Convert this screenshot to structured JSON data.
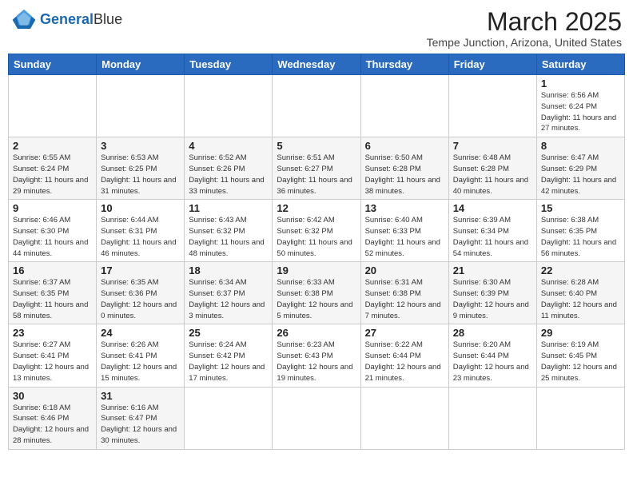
{
  "header": {
    "logo_general": "General",
    "logo_blue": "Blue",
    "month_title": "March 2025",
    "location": "Tempe Junction, Arizona, United States"
  },
  "days_of_week": [
    "Sunday",
    "Monday",
    "Tuesday",
    "Wednesday",
    "Thursday",
    "Friday",
    "Saturday"
  ],
  "weeks": [
    [
      {
        "num": "",
        "info": ""
      },
      {
        "num": "",
        "info": ""
      },
      {
        "num": "",
        "info": ""
      },
      {
        "num": "",
        "info": ""
      },
      {
        "num": "",
        "info": ""
      },
      {
        "num": "",
        "info": ""
      },
      {
        "num": "1",
        "info": "Sunrise: 6:56 AM\nSunset: 6:24 PM\nDaylight: 11 hours and 27 minutes."
      }
    ],
    [
      {
        "num": "2",
        "info": "Sunrise: 6:55 AM\nSunset: 6:24 PM\nDaylight: 11 hours and 29 minutes."
      },
      {
        "num": "3",
        "info": "Sunrise: 6:53 AM\nSunset: 6:25 PM\nDaylight: 11 hours and 31 minutes."
      },
      {
        "num": "4",
        "info": "Sunrise: 6:52 AM\nSunset: 6:26 PM\nDaylight: 11 hours and 33 minutes."
      },
      {
        "num": "5",
        "info": "Sunrise: 6:51 AM\nSunset: 6:27 PM\nDaylight: 11 hours and 36 minutes."
      },
      {
        "num": "6",
        "info": "Sunrise: 6:50 AM\nSunset: 6:28 PM\nDaylight: 11 hours and 38 minutes."
      },
      {
        "num": "7",
        "info": "Sunrise: 6:48 AM\nSunset: 6:28 PM\nDaylight: 11 hours and 40 minutes."
      },
      {
        "num": "8",
        "info": "Sunrise: 6:47 AM\nSunset: 6:29 PM\nDaylight: 11 hours and 42 minutes."
      }
    ],
    [
      {
        "num": "9",
        "info": "Sunrise: 6:46 AM\nSunset: 6:30 PM\nDaylight: 11 hours and 44 minutes."
      },
      {
        "num": "10",
        "info": "Sunrise: 6:44 AM\nSunset: 6:31 PM\nDaylight: 11 hours and 46 minutes."
      },
      {
        "num": "11",
        "info": "Sunrise: 6:43 AM\nSunset: 6:32 PM\nDaylight: 11 hours and 48 minutes."
      },
      {
        "num": "12",
        "info": "Sunrise: 6:42 AM\nSunset: 6:32 PM\nDaylight: 11 hours and 50 minutes."
      },
      {
        "num": "13",
        "info": "Sunrise: 6:40 AM\nSunset: 6:33 PM\nDaylight: 11 hours and 52 minutes."
      },
      {
        "num": "14",
        "info": "Sunrise: 6:39 AM\nSunset: 6:34 PM\nDaylight: 11 hours and 54 minutes."
      },
      {
        "num": "15",
        "info": "Sunrise: 6:38 AM\nSunset: 6:35 PM\nDaylight: 11 hours and 56 minutes."
      }
    ],
    [
      {
        "num": "16",
        "info": "Sunrise: 6:37 AM\nSunset: 6:35 PM\nDaylight: 11 hours and 58 minutes."
      },
      {
        "num": "17",
        "info": "Sunrise: 6:35 AM\nSunset: 6:36 PM\nDaylight: 12 hours and 0 minutes."
      },
      {
        "num": "18",
        "info": "Sunrise: 6:34 AM\nSunset: 6:37 PM\nDaylight: 12 hours and 3 minutes."
      },
      {
        "num": "19",
        "info": "Sunrise: 6:33 AM\nSunset: 6:38 PM\nDaylight: 12 hours and 5 minutes."
      },
      {
        "num": "20",
        "info": "Sunrise: 6:31 AM\nSunset: 6:38 PM\nDaylight: 12 hours and 7 minutes."
      },
      {
        "num": "21",
        "info": "Sunrise: 6:30 AM\nSunset: 6:39 PM\nDaylight: 12 hours and 9 minutes."
      },
      {
        "num": "22",
        "info": "Sunrise: 6:28 AM\nSunset: 6:40 PM\nDaylight: 12 hours and 11 minutes."
      }
    ],
    [
      {
        "num": "23",
        "info": "Sunrise: 6:27 AM\nSunset: 6:41 PM\nDaylight: 12 hours and 13 minutes."
      },
      {
        "num": "24",
        "info": "Sunrise: 6:26 AM\nSunset: 6:41 PM\nDaylight: 12 hours and 15 minutes."
      },
      {
        "num": "25",
        "info": "Sunrise: 6:24 AM\nSunset: 6:42 PM\nDaylight: 12 hours and 17 minutes."
      },
      {
        "num": "26",
        "info": "Sunrise: 6:23 AM\nSunset: 6:43 PM\nDaylight: 12 hours and 19 minutes."
      },
      {
        "num": "27",
        "info": "Sunrise: 6:22 AM\nSunset: 6:44 PM\nDaylight: 12 hours and 21 minutes."
      },
      {
        "num": "28",
        "info": "Sunrise: 6:20 AM\nSunset: 6:44 PM\nDaylight: 12 hours and 23 minutes."
      },
      {
        "num": "29",
        "info": "Sunrise: 6:19 AM\nSunset: 6:45 PM\nDaylight: 12 hours and 25 minutes."
      }
    ],
    [
      {
        "num": "30",
        "info": "Sunrise: 6:18 AM\nSunset: 6:46 PM\nDaylight: 12 hours and 28 minutes."
      },
      {
        "num": "31",
        "info": "Sunrise: 6:16 AM\nSunset: 6:47 PM\nDaylight: 12 hours and 30 minutes."
      },
      {
        "num": "",
        "info": ""
      },
      {
        "num": "",
        "info": ""
      },
      {
        "num": "",
        "info": ""
      },
      {
        "num": "",
        "info": ""
      },
      {
        "num": "",
        "info": ""
      }
    ]
  ]
}
